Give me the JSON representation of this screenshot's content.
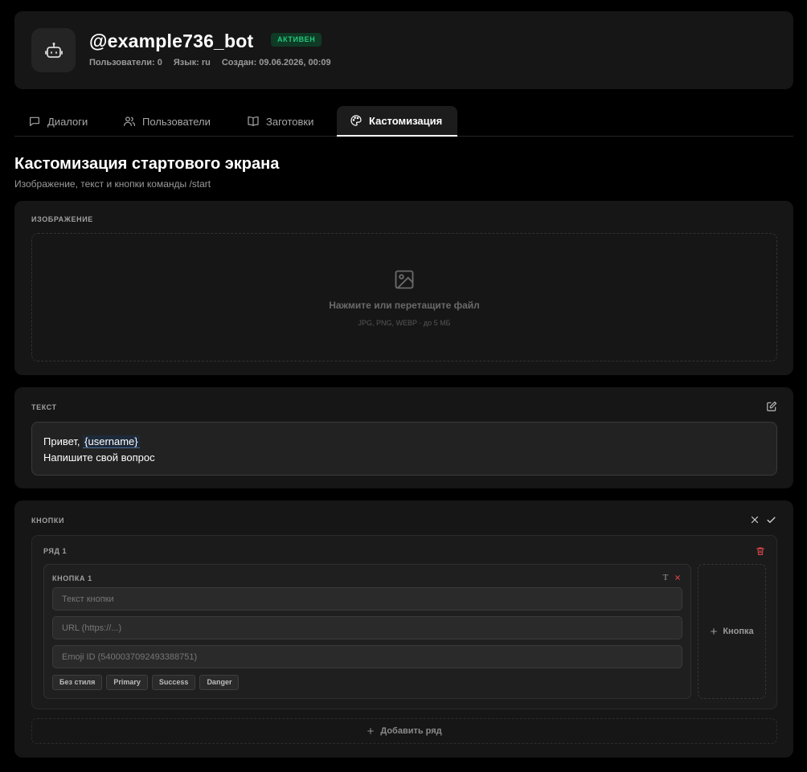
{
  "bot": {
    "name": "@example736_bot",
    "status": "АКТИВЕН",
    "meta": {
      "users": "Пользователи: 0",
      "language": "Язык: ru",
      "created": "Создан: 09.06.2026, 00:09"
    }
  },
  "tabs": [
    {
      "label": "Диалоги",
      "icon": "chat-icon"
    },
    {
      "label": "Пользователи",
      "icon": "users-icon"
    },
    {
      "label": "Заготовки",
      "icon": "book-icon"
    },
    {
      "label": "Кастомизация",
      "icon": "palette-icon",
      "active": true
    }
  ],
  "page": {
    "title": "Кастомизация стартового экрана",
    "subtitle": "Изображение, текст и кнопки команды /start"
  },
  "image_section": {
    "label": "ИЗОБРАЖЕНИЕ",
    "drop_text": "Нажмите или перетащите файл",
    "drop_hint": "JPG, PNG, WEBP · до 5 МБ"
  },
  "text_section": {
    "label": "ТЕКСТ",
    "greeting": "Привет, ",
    "variable": "{username}",
    "line2": "Напишите свой вопрос"
  },
  "buttons_section": {
    "label": "КНОПКИ",
    "row": {
      "label": "РЯД 1",
      "button": {
        "label": "КНОПКА 1",
        "text_placeholder": "Текст кнопки",
        "url_placeholder": "URL (https://...)",
        "emoji_placeholder": "Emoji ID (5400037092493388751)",
        "styles": [
          "Без стиля",
          "Primary",
          "Success",
          "Danger"
        ]
      },
      "add_button_label": "Кнопка"
    },
    "add_row_label": "Добавить ряд"
  },
  "colors": {
    "accent_active": "#22c97a",
    "danger": "#e5484d",
    "background": "#000000",
    "card": "#161616"
  }
}
